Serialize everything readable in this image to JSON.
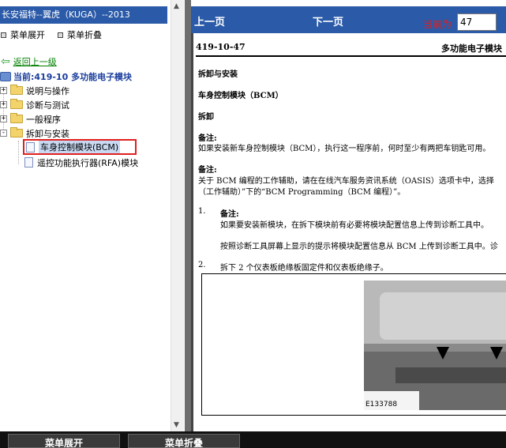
{
  "tree_panel": {
    "title": "长安福特--翼虎（KUGA）--2013",
    "expand_all": "菜单展开",
    "collapse_all": "菜单折叠",
    "back_link": "返回上一级",
    "current_label": "当前:419-10 多功能电子模块",
    "items": [
      {
        "label": "说明与操作",
        "expander": "+"
      },
      {
        "label": "诊断与测试",
        "expander": "+"
      },
      {
        "label": "一般程序",
        "expander": "+"
      },
      {
        "label": "拆卸与安装",
        "expander": "-"
      }
    ],
    "children": [
      {
        "label": "车身控制模块(BCM)",
        "selected": true
      },
      {
        "label": "遥控功能执行器(RFA)模块",
        "selected": false
      }
    ]
  },
  "nav": {
    "prev": "上一页",
    "next": "下一页",
    "page_label": "当前为",
    "page_value": "47"
  },
  "doc": {
    "code": "419-10-47",
    "module": "多功能电子模块",
    "section": "拆卸与安装",
    "subtitle": "车身控制模块（BCM）",
    "heading": "拆卸",
    "note1_title": "备注:",
    "note1_text": "如果安装新车身控制模块（BCM），执行这一程序前，何时至少有两把车钥匙可用。",
    "note2_title": "备注:",
    "note2_line1": "关于 BCM 编程的工作辅助，请在在线汽车服务资讯系统（OASIS）选项卡中，选择",
    "note2_line2": "（工作辅助）”下的“BCM Programming（BCM 编程）”。",
    "step1_num": "1.",
    "step1_note": "备注:",
    "step1_text": "如果要安装新模块，在拆下模块前有必要将模块配置信息上传到诊断工具中。",
    "step1_text2": "按照诊断工具屏幕上显示的提示将模块配置信息从 BCM 上传到诊断工具中。诊",
    "step2_num": "2.",
    "step2_text": "拆下 2 个仪表板绝缘板固定件和仪表板绝缘子。",
    "figure_id": "E133788"
  },
  "bottom": {
    "expand_btn": "菜单展开",
    "collapse_btn": "菜单折叠"
  }
}
